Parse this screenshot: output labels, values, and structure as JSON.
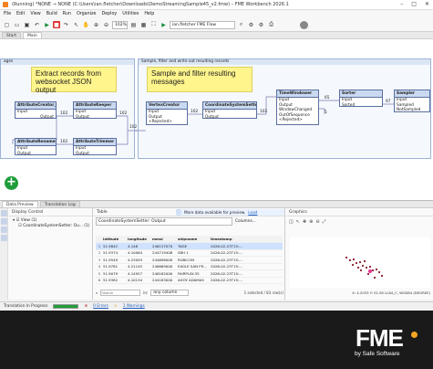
{
  "window": {
    "title": "(Running) *NONE → NONE (C:\\Users\\ian.fletcher\\Downloads\\DemoStreamingSample45_v2.fmw) – FME Workbench 2026.1",
    "app_name": "",
    "controls": [
      "–",
      "□",
      "✕"
    ]
  },
  "menu": [
    "File",
    "Edit",
    "View",
    "Build",
    "Run",
    "Organize",
    "Deploy",
    "Utilities",
    "Help"
  ],
  "toolbar": {
    "zoom": "102%",
    "run_target": "ian.fletcher FME Flow",
    "icons": [
      "new-icon",
      "open-icon",
      "save-icon",
      "undo-icon",
      "redo-icon",
      "run-icon",
      "stop-icon",
      "pointer-icon",
      "pan-icon",
      "zoom-in-icon",
      "zoom-out-icon",
      "search-icon",
      "settings-icon",
      "gear-icon",
      "play-icon"
    ]
  },
  "tabs": [
    {
      "label": "Start",
      "active": false
    },
    {
      "label": "Main",
      "active": true
    }
  ],
  "canvas": {
    "bookmark_left": {
      "title": "ages"
    },
    "bookmark_right": {
      "title": "Sample, filter and write out resulting records"
    },
    "note_left": "Extract records from websocket JSON output",
    "note_right": "Sample and filter resulting messages",
    "transformers": [
      {
        "name": "AttributeCreator_2",
        "ports": [
          "Input",
          "Output"
        ]
      },
      {
        "name": "AttributeKeeper",
        "ports": [
          "Input",
          "Output"
        ]
      },
      {
        "name": "VertexCreator",
        "ports": [
          "Input",
          "Output",
          "<Rejected>"
        ]
      },
      {
        "name": "CoordinateSystemSetter",
        "ports": [
          "Input",
          "Output"
        ]
      },
      {
        "name": "TimeWindower",
        "ports": [
          "Input",
          "Output",
          "WindowChanged",
          "OutOfSequence",
          "<Rejected>"
        ]
      },
      {
        "name": "Sorter",
        "ports": [
          "Input",
          "Sorted"
        ]
      },
      {
        "name": "Sampler",
        "ports": [
          "Input",
          "Sampled",
          "NotSampled"
        ]
      },
      {
        "name": "AttributeRenamer",
        "ports": [
          "Input",
          "Output"
        ]
      },
      {
        "name": "AttributeTrimmer",
        "ports": [
          "Input",
          "Output"
        ]
      }
    ],
    "counts": {
      "c1": "102",
      "c2": "102",
      "c3": "102",
      "c4": "102",
      "c5": "102",
      "c6": "102",
      "c7": "65",
      "c8": "97",
      "c9": "5"
    }
  },
  "data_preview": {
    "tabs": [
      {
        "label": "Data Preview",
        "active": true
      },
      {
        "label": "Translation Log",
        "active": false
      }
    ],
    "notice": "More data available for preview.",
    "notice_link": "Load",
    "display_control": {
      "title": "Display Control",
      "tree": [
        "View (1)",
        "CoordinateSystemSetter: Ou... (1)"
      ]
    },
    "table": {
      "title": "Table",
      "source": "CoordinateSystemSetter: Output",
      "columns_btn": "Columns...",
      "headers": [
        "latitude",
        "longitude",
        "mmsi",
        "shipname",
        "timestamp"
      ],
      "rows": [
        [
          "1",
          "51.9842",
          "4.148",
          "246137070",
          "TAGE",
          "2026-02-23T15:..."
        ],
        [
          "2",
          "51.9374",
          "4.10064",
          "244719408",
          "SBH 1",
          "2026-02-23T15:..."
        ],
        [
          "3",
          "51.9549",
          "4.23093",
          "244698000",
          "RUBICON",
          "2026-02-23T15:..."
        ],
        [
          "4",
          "51.9781",
          "4.21145",
          "248669000",
          "EAGLE SAN FR...",
          "2026-02-23T15:..."
        ],
        [
          "5",
          "51.9079",
          "4.14957",
          "246162000",
          "FAIRPLAY-35",
          "2026-02-23T15:..."
        ],
        [
          "6",
          "51.9382",
          "4.10134",
          "244183000",
          "AHOY ADAMAS",
          "2026-02-23T15:..."
        ]
      ],
      "search_placeholder": "Search",
      "column_filter": "any column",
      "selection": "1 selected / 83 row(s)"
    },
    "graphics": {
      "title": "Graphics",
      "coords": "X: 4.2033  Y: 51.90  LL84_C, WGS84 (DEGREE)"
    }
  },
  "status": {
    "translation": "Translation In Progress",
    "errors": "0 Errors",
    "warnings": "1 Warnings"
  },
  "brand": {
    "logo": "FME",
    "tagline": "by Safe Software"
  },
  "colors": {
    "accent": "#1f9d3a",
    "note": "#fff58c",
    "header": "#c9d9f0",
    "selected": "#cfe2ff"
  }
}
